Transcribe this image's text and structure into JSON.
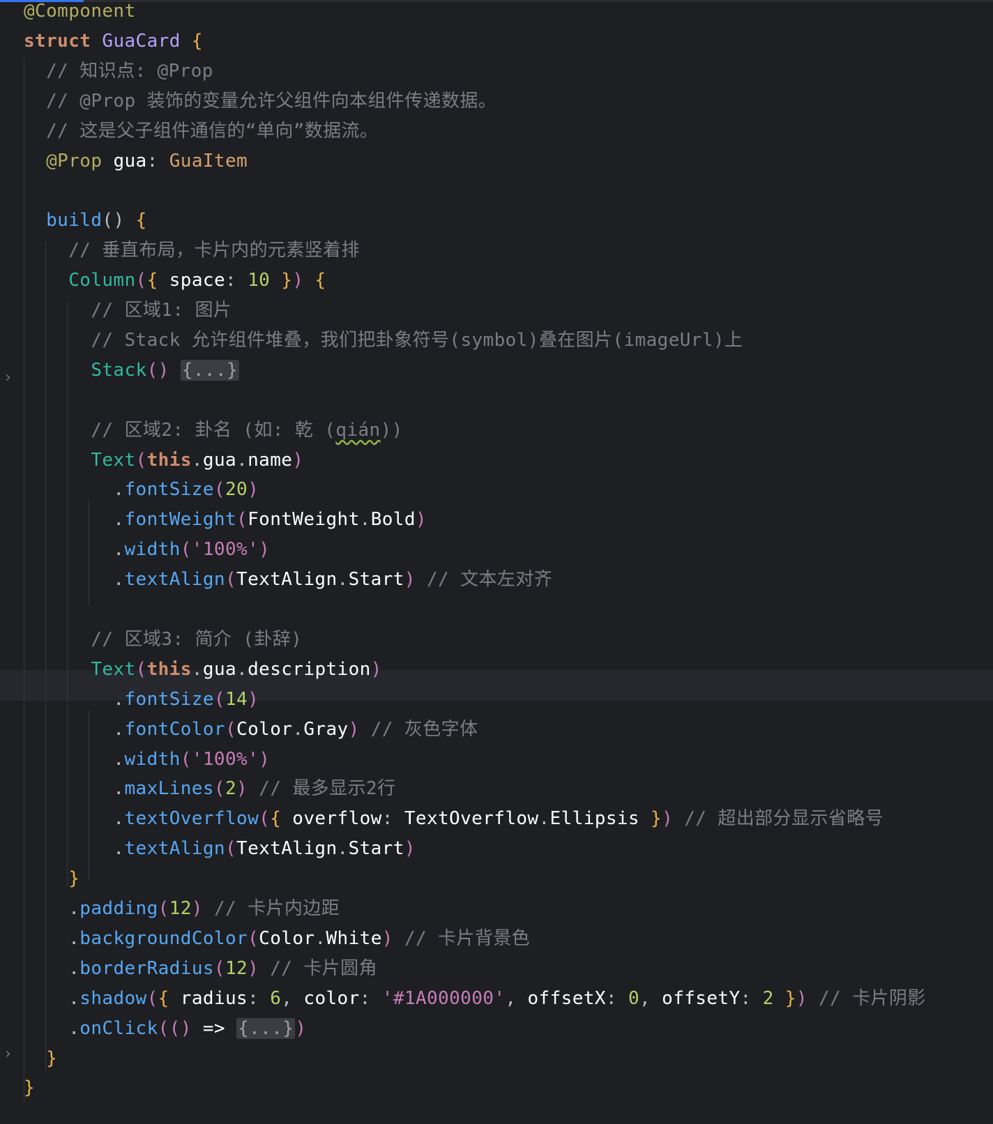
{
  "editor": {
    "lines": [
      {
        "id": "l1",
        "parts": [
          [
            "ann",
            "@Component"
          ]
        ]
      },
      {
        "id": "l2",
        "parts": [
          [
            "kw",
            "struct"
          ],
          [
            "punct",
            " "
          ],
          [
            "cls",
            "GuaCard"
          ],
          [
            "punct",
            " "
          ],
          [
            "brace",
            "{"
          ]
        ]
      },
      {
        "id": "l3",
        "parts": [
          [
            "cm",
            "  // 知识点: @Prop"
          ]
        ]
      },
      {
        "id": "l4",
        "parts": [
          [
            "cm",
            "  // @Prop 装饰的变量允许父组件向本组件传递数据。"
          ]
        ]
      },
      {
        "id": "l5",
        "parts": [
          [
            "cm",
            "  // 这是父子组件通信的“单向”数据流。"
          ]
        ]
      },
      {
        "id": "l6",
        "parts": [
          [
            "punct",
            "  "
          ],
          [
            "ann",
            "@Prop"
          ],
          [
            "plain",
            " gua"
          ],
          [
            "punct",
            ": "
          ],
          [
            "typeref",
            "GuaItem"
          ]
        ]
      },
      {
        "id": "l7",
        "parts": [
          [
            "punct",
            ""
          ]
        ]
      },
      {
        "id": "l8",
        "parts": [
          [
            "punct",
            "  "
          ],
          [
            "fn",
            "build"
          ],
          [
            "punct",
            "() "
          ],
          [
            "brace",
            "{"
          ]
        ]
      },
      {
        "id": "l9",
        "parts": [
          [
            "cm",
            "    // 垂直布局，卡片内的元素竖着排"
          ]
        ]
      },
      {
        "id": "l10",
        "parts": [
          [
            "punct",
            "    "
          ],
          [
            "comp",
            "Column"
          ],
          [
            "paren",
            "("
          ],
          [
            "brace",
            "{"
          ],
          [
            "plain",
            " space"
          ],
          [
            "punct",
            ": "
          ],
          [
            "numg",
            "10"
          ],
          [
            "punct",
            " "
          ],
          [
            "brace",
            "}"
          ],
          [
            "paren",
            ")"
          ],
          [
            "punct",
            " "
          ],
          [
            "brace",
            "{"
          ]
        ]
      },
      {
        "id": "l11",
        "parts": [
          [
            "cm",
            "      // 区域1: 图片"
          ]
        ]
      },
      {
        "id": "l12",
        "parts": [
          [
            "cm",
            "      // Stack 允许组件堆叠，我们把卦象符号(symbol)叠在图片(imageUrl)上"
          ]
        ]
      },
      {
        "id": "l13",
        "parts": [
          [
            "punct",
            "      "
          ],
          [
            "comp",
            "Stack"
          ],
          [
            "paren",
            "()"
          ],
          [
            "punct",
            " "
          ],
          [
            "folded",
            "{...}"
          ]
        ]
      },
      {
        "id": "l14",
        "parts": [
          [
            "punct",
            ""
          ]
        ]
      },
      {
        "id": "l15",
        "parts": [
          [
            "cm",
            "      // 区域2: 卦名 (如: 乾 ("
          ],
          [
            "cmsq",
            "qián"
          ],
          [
            "cm",
            "))"
          ]
        ]
      },
      {
        "id": "l16",
        "parts": [
          [
            "punct",
            "      "
          ],
          [
            "comp",
            "Text"
          ],
          [
            "paren",
            "("
          ],
          [
            "kwb",
            "this"
          ],
          [
            "punct",
            "."
          ],
          [
            "plain",
            "gua"
          ],
          [
            "punct",
            "."
          ],
          [
            "plain",
            "name"
          ],
          [
            "paren",
            ")"
          ]
        ]
      },
      {
        "id": "l17",
        "parts": [
          [
            "punct",
            "        ."
          ],
          [
            "method",
            "fontSize"
          ],
          [
            "paren",
            "("
          ],
          [
            "numg",
            "20"
          ],
          [
            "paren",
            ")"
          ]
        ]
      },
      {
        "id": "l18",
        "parts": [
          [
            "punct",
            "        ."
          ],
          [
            "method",
            "fontWeight"
          ],
          [
            "paren",
            "("
          ],
          [
            "plain",
            "FontWeight"
          ],
          [
            "punct",
            "."
          ],
          [
            "plain",
            "Bold"
          ],
          [
            "paren",
            ")"
          ]
        ]
      },
      {
        "id": "l19",
        "parts": [
          [
            "punct",
            "        ."
          ],
          [
            "method",
            "width"
          ],
          [
            "paren",
            "("
          ],
          [
            "str",
            "'100%'"
          ],
          [
            "paren",
            ")"
          ]
        ]
      },
      {
        "id": "l20",
        "parts": [
          [
            "punct",
            "        ."
          ],
          [
            "method",
            "textAlign"
          ],
          [
            "paren",
            "("
          ],
          [
            "plain",
            "TextAlign"
          ],
          [
            "punct",
            "."
          ],
          [
            "plain",
            "Start"
          ],
          [
            "paren",
            ")"
          ],
          [
            "cm",
            " // 文本左对齐"
          ]
        ]
      },
      {
        "id": "l21",
        "parts": [
          [
            "punct",
            ""
          ]
        ]
      },
      {
        "id": "l22",
        "parts": [
          [
            "cm",
            "      // 区域3: 简介 (卦辞)"
          ]
        ]
      },
      {
        "id": "l23",
        "parts": [
          [
            "punct",
            "      "
          ],
          [
            "comp",
            "Text"
          ],
          [
            "paren",
            "("
          ],
          [
            "kwb",
            "this"
          ],
          [
            "punct",
            "."
          ],
          [
            "plain",
            "gua"
          ],
          [
            "punct",
            "."
          ],
          [
            "plain",
            "description"
          ],
          [
            "paren",
            ")"
          ]
        ]
      },
      {
        "id": "l24",
        "parts": [
          [
            "punct",
            "        ."
          ],
          [
            "method",
            "fontSize"
          ],
          [
            "paren",
            "("
          ],
          [
            "numg",
            "14"
          ],
          [
            "paren",
            ")"
          ]
        ]
      },
      {
        "id": "l25",
        "parts": [
          [
            "punct",
            "        ."
          ],
          [
            "method",
            "fontColor"
          ],
          [
            "paren",
            "("
          ],
          [
            "plain",
            "Color"
          ],
          [
            "punct",
            "."
          ],
          [
            "plain",
            "Gray"
          ],
          [
            "paren",
            ")"
          ],
          [
            "cm",
            " // 灰色字体"
          ]
        ]
      },
      {
        "id": "l26",
        "parts": [
          [
            "punct",
            "        ."
          ],
          [
            "method",
            "width"
          ],
          [
            "paren",
            "("
          ],
          [
            "str",
            "'100%'"
          ],
          [
            "paren",
            ")"
          ]
        ]
      },
      {
        "id": "l27",
        "parts": [
          [
            "punct",
            "        ."
          ],
          [
            "method",
            "maxLines"
          ],
          [
            "paren",
            "("
          ],
          [
            "numg",
            "2"
          ],
          [
            "paren",
            ")"
          ],
          [
            "cm",
            " // 最多显示2行"
          ]
        ]
      },
      {
        "id": "l28",
        "parts": [
          [
            "punct",
            "        ."
          ],
          [
            "method",
            "textOverflow"
          ],
          [
            "paren",
            "("
          ],
          [
            "brace",
            "{"
          ],
          [
            "plain",
            " overflow"
          ],
          [
            "punct",
            ": "
          ],
          [
            "plain",
            "TextOverflow"
          ],
          [
            "punct",
            "."
          ],
          [
            "plain",
            "Ellipsis"
          ],
          [
            "punct",
            " "
          ],
          [
            "brace",
            "}"
          ],
          [
            "paren",
            ")"
          ],
          [
            "cm",
            " // 超出部分显示省略号"
          ]
        ]
      },
      {
        "id": "l29",
        "parts": [
          [
            "punct",
            "        ."
          ],
          [
            "method",
            "textAlign"
          ],
          [
            "paren",
            "("
          ],
          [
            "plain",
            "TextAlign"
          ],
          [
            "punct",
            "."
          ],
          [
            "plain",
            "Start"
          ],
          [
            "paren",
            ")"
          ]
        ]
      },
      {
        "id": "l30",
        "parts": [
          [
            "punct",
            "    "
          ],
          [
            "brace",
            "}"
          ]
        ]
      },
      {
        "id": "l31",
        "parts": [
          [
            "punct",
            "    ."
          ],
          [
            "method",
            "padding"
          ],
          [
            "paren",
            "("
          ],
          [
            "numg",
            "12"
          ],
          [
            "paren",
            ")"
          ],
          [
            "cm",
            " // 卡片内边距"
          ]
        ]
      },
      {
        "id": "l32",
        "parts": [
          [
            "punct",
            "    ."
          ],
          [
            "method",
            "backgroundColor"
          ],
          [
            "paren",
            "("
          ],
          [
            "plain",
            "Color"
          ],
          [
            "punct",
            "."
          ],
          [
            "plain",
            "White"
          ],
          [
            "paren",
            ")"
          ],
          [
            "cm",
            " // 卡片背景色"
          ]
        ]
      },
      {
        "id": "l33",
        "parts": [
          [
            "punct",
            "    ."
          ],
          [
            "method",
            "borderRadius"
          ],
          [
            "paren",
            "("
          ],
          [
            "numg",
            "12"
          ],
          [
            "paren",
            ")"
          ],
          [
            "cm",
            " // 卡片圆角"
          ]
        ]
      },
      {
        "id": "l34",
        "parts": [
          [
            "punct",
            "    ."
          ],
          [
            "method",
            "shadow"
          ],
          [
            "paren",
            "("
          ],
          [
            "brace",
            "{"
          ],
          [
            "plain",
            " radius"
          ],
          [
            "punct",
            ": "
          ],
          [
            "numg",
            "6"
          ],
          [
            "punct",
            ", "
          ],
          [
            "plain",
            "color"
          ],
          [
            "punct",
            ": "
          ],
          [
            "str",
            "'#1A000000'"
          ],
          [
            "punct",
            ", "
          ],
          [
            "plain",
            "offsetX"
          ],
          [
            "punct",
            ": "
          ],
          [
            "numg",
            "0"
          ],
          [
            "punct",
            ", "
          ],
          [
            "plain",
            "offsetY"
          ],
          [
            "punct",
            ": "
          ],
          [
            "numg",
            "2"
          ],
          [
            "punct",
            " "
          ],
          [
            "brace",
            "}"
          ],
          [
            "paren",
            ")"
          ],
          [
            "cm",
            " // 卡片阴影"
          ]
        ]
      },
      {
        "id": "l35",
        "parts": [
          [
            "punct",
            "    ."
          ],
          [
            "method",
            "onClick"
          ],
          [
            "paren",
            "(()"
          ],
          [
            "plain",
            " =>"
          ],
          [
            "punct",
            " "
          ],
          [
            "folded",
            "{...}"
          ],
          [
            "paren",
            ")"
          ]
        ]
      },
      {
        "id": "l36",
        "parts": [
          [
            "punct",
            "  "
          ],
          [
            "brace",
            "}"
          ]
        ]
      },
      {
        "id": "l37",
        "parts": [
          [
            "brace",
            "}"
          ]
        ]
      }
    ]
  },
  "colors": {
    "background": "#1e1f22",
    "current_line": "#26282e",
    "accent": "#3574f0"
  },
  "icons": {
    "fold_arrow": "chevron-right-icon"
  }
}
